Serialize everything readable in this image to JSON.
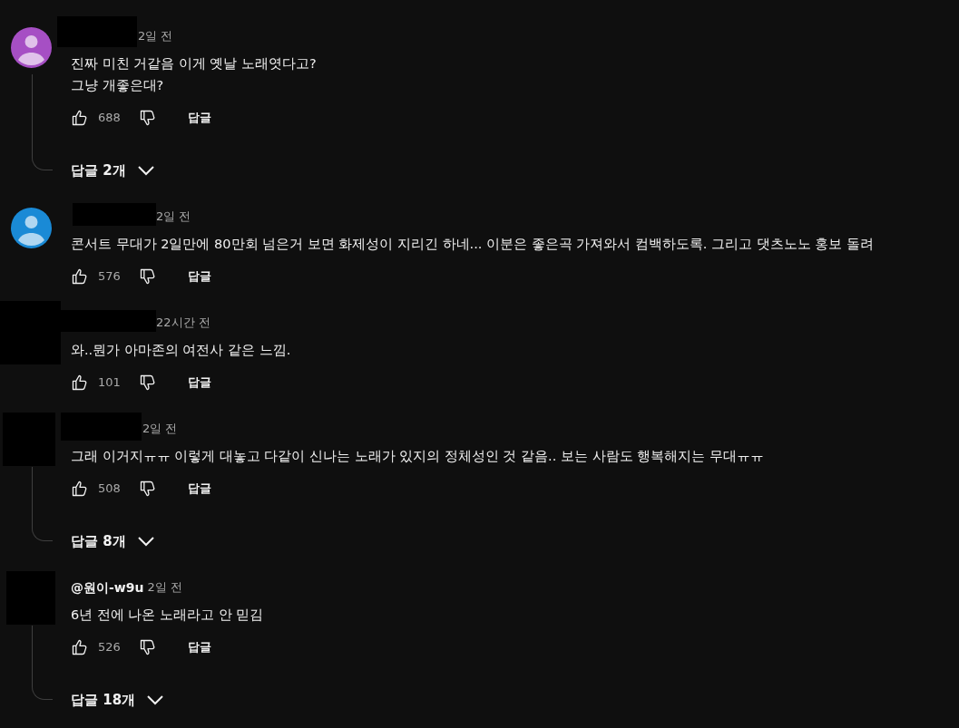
{
  "comments": [
    {
      "avatar": {
        "kind": "default",
        "color": "#a64fc4"
      },
      "author": {
        "hidden": true
      },
      "time": "2일 전",
      "lines": [
        "진짜 미친 거같음 이게 옛날 노래엿다고?",
        "그냥 개좋은대?"
      ],
      "likes": "688",
      "reply_label": "답글",
      "replies": "답글 2개"
    },
    {
      "avatar": {
        "kind": "default",
        "color": "#1a8ad6"
      },
      "author": {
        "hidden": true
      },
      "time": "2일 전",
      "lines": [
        "콘서트 무대가 2일만에 80만회 넘은거 보면 화제성이 지리긴 하네... 이분은 좋은곡 가져와서 컴백하도록. 그리고 댓츠노노 홍보 돌려"
      ],
      "likes": "576",
      "reply_label": "답글"
    },
    {
      "avatar": {
        "kind": "hidden"
      },
      "author": {
        "hidden": true
      },
      "time": "22시간 전",
      "lines": [
        "와..뭔가 아마존의 여전사 같은 느낌."
      ],
      "likes": "101",
      "reply_label": "답글"
    },
    {
      "avatar": {
        "kind": "hidden"
      },
      "author": {
        "hidden": true
      },
      "time": "2일 전",
      "lines": [
        "그래 이거지ㅠㅠ 이렇게 대놓고 다같이 신나는 노래가 있지의 정체성인 것 같음.. 보는 사람도 행복해지는 무대ㅠㅠ"
      ],
      "likes": "508",
      "reply_label": "답글",
      "replies": "답글 8개"
    },
    {
      "avatar": {
        "kind": "hidden"
      },
      "author": {
        "hidden": false,
        "name": "@원이-w9u"
      },
      "time": "2일 전",
      "lines": [
        "6년 전에 나온 노래라고 안 믿김"
      ],
      "likes": "526",
      "reply_label": "답글",
      "replies": "답글 18개"
    }
  ]
}
